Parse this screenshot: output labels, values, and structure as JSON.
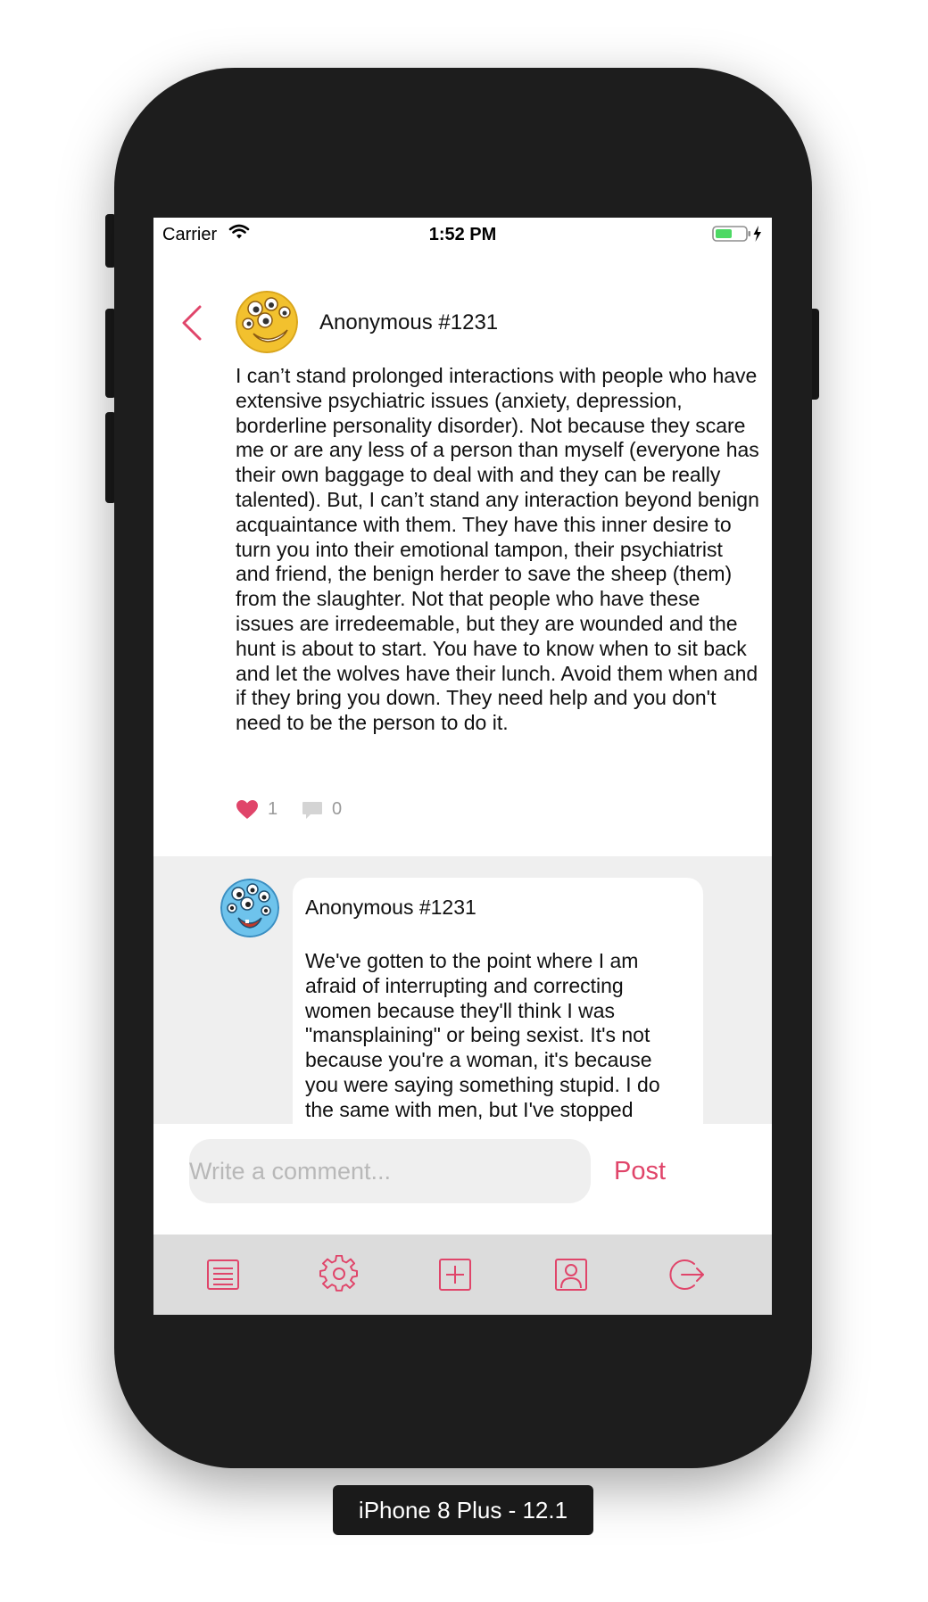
{
  "status_bar": {
    "carrier": "Carrier",
    "time": "1:52 PM"
  },
  "post": {
    "author": "Anonymous #1231",
    "body": "I can’t stand prolonged interactions with people who have extensive psychiatric issues (anxiety, depression, borderline personality disorder). Not because they scare me or are any less of a person than myself (everyone has their own baggage to deal with and they can be really talented). But, I can’t stand any interaction beyond benign acquaintance with them. They have this inner desire to turn you into their emotional tampon, their psychiatrist and friend, the benign herder to save the sheep (them) from the slaughter. Not that people who have these issues are irredeemable, but they are wounded and the hunt is about to start. You have to know when to sit back and let the wolves have their lunch. Avoid them when and if they bring you down. They need help and you don't need to be the person to do it.",
    "likes": "1",
    "comments": "0"
  },
  "comments": [
    {
      "author": "Anonymous #1231",
      "body": "We've gotten to the point where I am afraid of interrupting and correcting women because they'll think I was \"mansplaining\" or being sexist. It's not because you're a woman, it's because you were saying something stupid. I do the same with men, but I've stopped"
    }
  ],
  "composer": {
    "placeholder": "Write a comment...",
    "post_label": "Post"
  },
  "tab_bar": {
    "items": [
      "list-icon",
      "gear-icon",
      "add-icon",
      "profile-icon",
      "logout-icon"
    ]
  },
  "device_label": "iPhone 8 Plus - 12.1",
  "colors": {
    "accent": "#e0456a",
    "comments_background": "#efefef",
    "tab_bar_background": "#dcdcdc",
    "device_frame": "#1d1d1d"
  }
}
